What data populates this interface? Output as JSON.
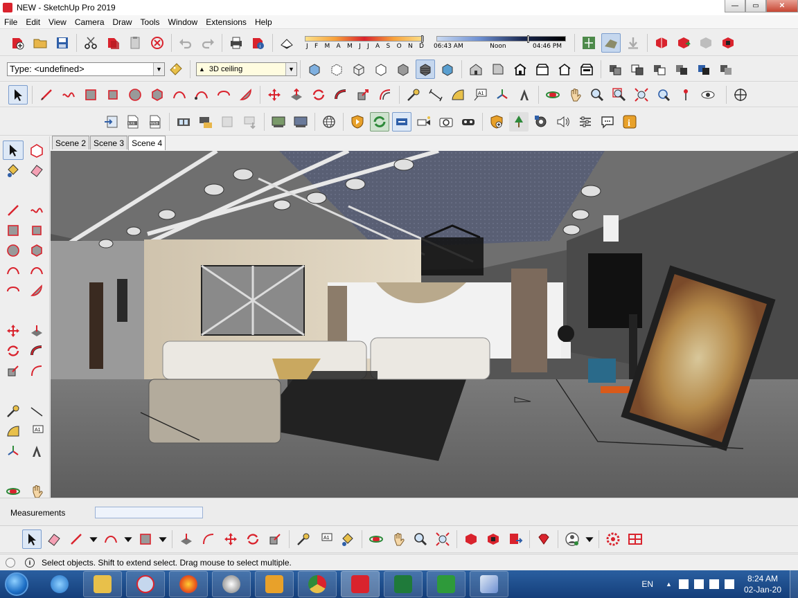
{
  "window": {
    "title": "NEW - SketchUp Pro 2019",
    "buttons": [
      "minimize",
      "maximize",
      "close"
    ]
  },
  "menu": [
    "File",
    "Edit",
    "View",
    "Camera",
    "Draw",
    "Tools",
    "Window",
    "Extensions",
    "Help"
  ],
  "shadow_settings": {
    "months": [
      "J",
      "F",
      "M",
      "A",
      "M",
      "J",
      "J",
      "A",
      "S",
      "O",
      "N",
      "D"
    ],
    "time_start": "06:43 AM",
    "time_mid": "Noon",
    "time_end": "04:46 PM"
  },
  "entity_info": {
    "type_label": "Type: <undefined>"
  },
  "layer": {
    "current": "3D ceiling"
  },
  "scenes": {
    "tabs": [
      "Scene 2",
      "Scene 3",
      "Scene 4"
    ],
    "active": "Scene 4"
  },
  "measurements": {
    "label": "Measurements",
    "value": ""
  },
  "status": {
    "text": "Select objects. Shift to extend select. Drag mouse to select multiple."
  },
  "taskbar": {
    "apps": [
      "internet-explorer",
      "file-explorer",
      "snipping-tool",
      "firefox",
      "media-player",
      "video-player",
      "chrome",
      "sketchup",
      "excel",
      "camtasia",
      "notes"
    ],
    "tray": {
      "language": "EN",
      "time": "8:24 AM",
      "date": "02-Jan-20"
    }
  },
  "colors": {
    "accent_red": "#d9232d",
    "taskbar": "#1e4f8f",
    "viewport_floor": "#6b6b6b",
    "ceiling_panel": "#545a6e"
  }
}
